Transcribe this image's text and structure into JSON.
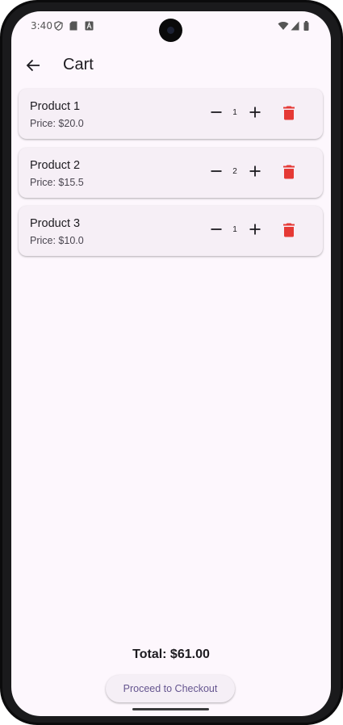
{
  "status_bar": {
    "time": "3:40",
    "left_icons": [
      "vpn-shield-icon",
      "sd-card-icon",
      "text-a-icon"
    ],
    "right_icons": [
      "wifi-icon",
      "cell-signal-icon",
      "battery-icon"
    ]
  },
  "app_bar": {
    "title": "Cart",
    "back_icon": "arrow-back-icon"
  },
  "cart": {
    "items": [
      {
        "name": "Product 1",
        "price": "Price: $20.0",
        "quantity": "1"
      },
      {
        "name": "Product 2",
        "price": "Price: $15.5",
        "quantity": "2"
      },
      {
        "name": "Product 3",
        "price": "Price: $10.0",
        "quantity": "1"
      }
    ],
    "total": "Total: $61.00",
    "checkout_label": "Proceed to Checkout"
  },
  "colors": {
    "background": "#fdf7fd",
    "card": "#f6eff6",
    "delete": "#e53935",
    "primary_text": "#1d1b20",
    "button_text": "#65558f"
  }
}
